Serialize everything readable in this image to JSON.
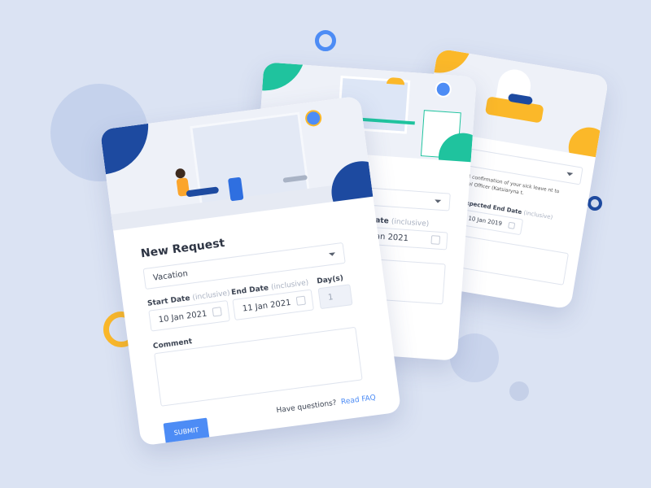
{
  "colors": {
    "background": "#dbe3f3",
    "accent_blue": "#4d8cf5",
    "navy": "#1d4aa0",
    "yellow": "#fbb829",
    "teal": "#1fc39e"
  },
  "front_card": {
    "title": "New Request",
    "leave_type": "Vacation",
    "start_date_label": "Start Date",
    "start_date_hint": "(inclusive)",
    "start_date_value": "10 Jan 2021",
    "end_date_label": "End Date",
    "end_date_hint": "(inclusive)",
    "end_date_value": "11 Jan 2021",
    "days_label": "Day(s)",
    "days_value": "1",
    "comment_label": "Comment",
    "comment_value": "",
    "submit_label": "SUBMIT",
    "faq_prompt": "Have questions?",
    "faq_link": "Read FAQ"
  },
  "middle_card": {
    "end_date_label_partial": "ate",
    "end_date_hint": "(inclusive)",
    "end_date_value_partial": "an 2021"
  },
  "back_card": {
    "info_text": "e official confirmation of your sick leave nt to Personnel Officer (Katsiaryna t.",
    "expected_end_label": "Expected End Date",
    "expected_end_hint": "(inclusive)",
    "expected_end_value": "10 Jan 2019"
  }
}
